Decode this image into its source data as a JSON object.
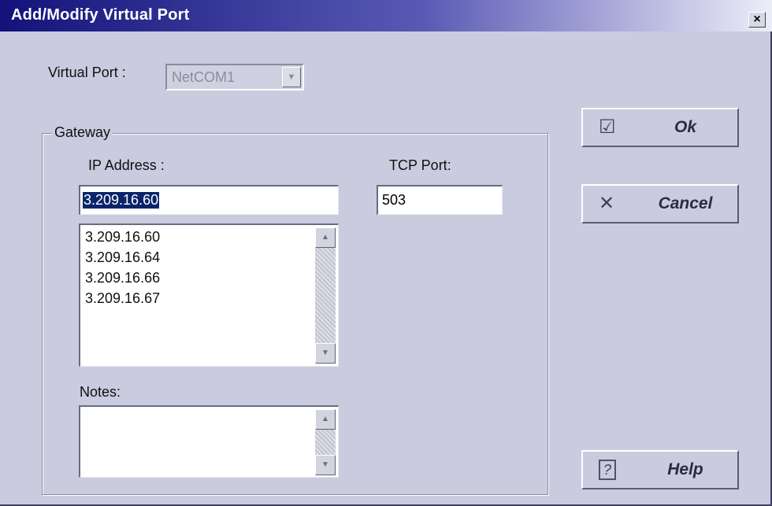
{
  "window": {
    "title": "Add/Modify Virtual Port",
    "close_glyph": "×"
  },
  "virtual_port": {
    "label": "Virtual Port :",
    "value": "NetCOM1",
    "arrow_glyph": "▼"
  },
  "gateway": {
    "legend": "Gateway",
    "ip_label": "IP Address :",
    "ip_value": "3.209.16.60",
    "tcp_label": "TCP Port:",
    "tcp_value": "503",
    "ip_list": [
      "3.209.16.60",
      "3.209.16.64",
      "3.209.16.66",
      "3.209.16.67"
    ],
    "notes_label": "Notes:",
    "notes_value": ""
  },
  "scroll": {
    "up_glyph": "▲",
    "down_glyph": "▼"
  },
  "buttons": {
    "ok": {
      "label": "Ok",
      "icon": "check-mail-icon",
      "glyph": "☑"
    },
    "cancel": {
      "label": "Cancel",
      "icon": "x-icon",
      "glyph": "✕"
    },
    "help": {
      "label": "Help",
      "icon": "help-icon",
      "glyph": "?"
    }
  },
  "colors": {
    "title_start": "#12127a",
    "title_end": "#ededf9",
    "dialog_bg": "#cbcbe0",
    "selection": "#0a246a"
  }
}
